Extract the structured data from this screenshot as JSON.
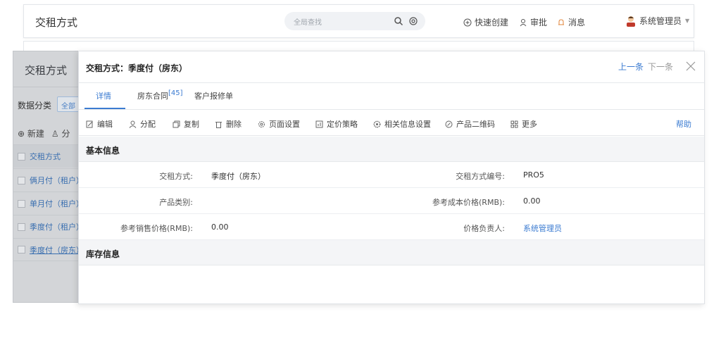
{
  "topbar": {
    "title": "交租方式",
    "search_placeholder": "全局查找",
    "quick_create": "快速创建",
    "approval": "审批",
    "messages": "消息",
    "user": "系统管理员"
  },
  "list": {
    "title": "交租方式",
    "category_label": "数据分类",
    "category_all": "全部",
    "new_label": "新建",
    "assign_label": "分",
    "header": "交租方式",
    "rows": [
      "俩月付（租户）",
      "单月付（租户）",
      "季度付（租户）",
      "季度付（房东）"
    ]
  },
  "detail": {
    "title": "交租方式：季度付（房东）",
    "prev": "上一条",
    "next": "下一条",
    "tabs": [
      {
        "label": "详情"
      },
      {
        "label": "房东合同",
        "count": "[45]"
      },
      {
        "label": "客户报修单"
      }
    ],
    "toolbar": {
      "edit": "编辑",
      "assign": "分配",
      "copy": "复制",
      "delete": "删除",
      "page_settings": "页面设置",
      "pricing": "定价策略",
      "related_settings": "相关信息设置",
      "qrcode": "产品二维码",
      "more": "更多",
      "help": "帮助"
    },
    "sections": {
      "basic": "基本信息",
      "inventory": "库存信息"
    },
    "fields": {
      "method_label": "交租方式:",
      "method_value": "季度付（房东）",
      "code_label": "交租方式编号:",
      "code_value": "PRO5",
      "category_label": "产品类别:",
      "category_value": "",
      "cost_label": "参考成本价格(RMB):",
      "cost_value": "0.00",
      "sale_label": "参考销售价格(RMB):",
      "sale_value": "0.00",
      "owner_label": "价格负责人:",
      "owner_value": "系统管理员"
    }
  },
  "colors": {
    "accent": "#3b7bd1",
    "section_bg": "#f4f5f7",
    "overlay": "#d3d5d8"
  }
}
